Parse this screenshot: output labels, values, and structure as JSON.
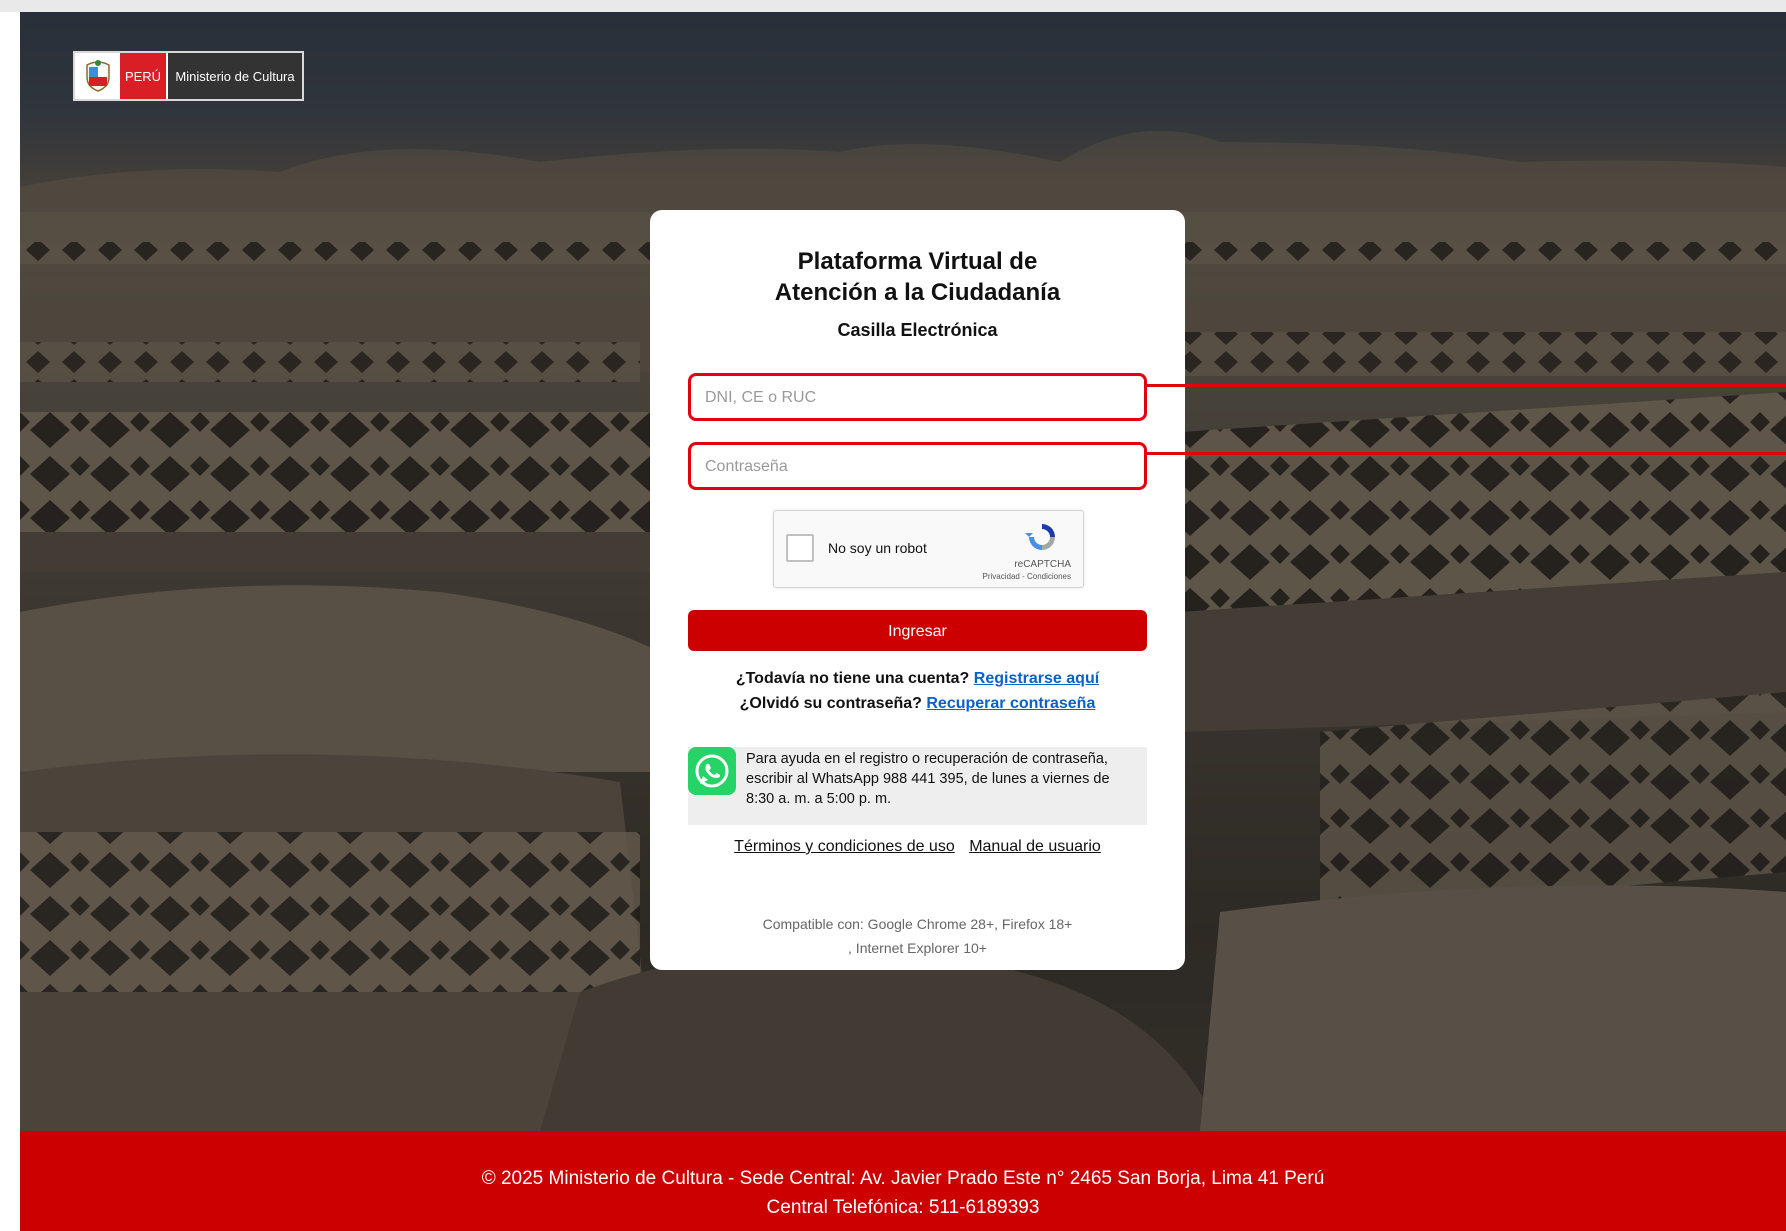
{
  "logo": {
    "country": "PERÚ",
    "ministry": "Ministerio de Cultura"
  },
  "card": {
    "title_line1": "Plataforma Virtual de",
    "title_line2": "Atención a la Ciudadanía",
    "subtitle": "Casilla Electrónica"
  },
  "login": {
    "user_placeholder": "DNI, CE o RUC",
    "user_value": "",
    "password_placeholder": "Contraseña",
    "password_value": "",
    "submit_label": "Ingresar"
  },
  "captcha": {
    "label": "No soy un robot",
    "brand": "reCAPTCHA",
    "links": "Privacidad - Condiciones"
  },
  "account": {
    "register_question": "¿Todavía no tiene una cuenta?",
    "register_link": "Registrarse aquí",
    "recover_question": "¿Olvidó su contraseña?",
    "recover_link": "Recuperar contraseña"
  },
  "help": {
    "icon": "whatsapp-icon",
    "text": "Para ayuda en el registro o recuperación de contraseña, escribir al WhatsApp 988 441 395, de lunes a viernes de 8:30 a. m. a 5:00 p. m."
  },
  "links": {
    "terms": "Términos y condiciones de uso",
    "manual": "Manual de usuario"
  },
  "compat": {
    "line1": "Compatible con: Google Chrome 28+, Firefox 18+",
    "line2": ", Internet Explorer 10+"
  },
  "footer": {
    "line1": "© 2025 Ministerio de Cultura - Sede Central: Av. Javier Prado Este n° 2465 San Borja, Lima 41 Perú",
    "line2": "Central Telefónica: 511-6189393"
  },
  "colors": {
    "brand_red": "#cc0000",
    "highlight_red": "#e3000f",
    "link_blue": "#0a62c9"
  }
}
